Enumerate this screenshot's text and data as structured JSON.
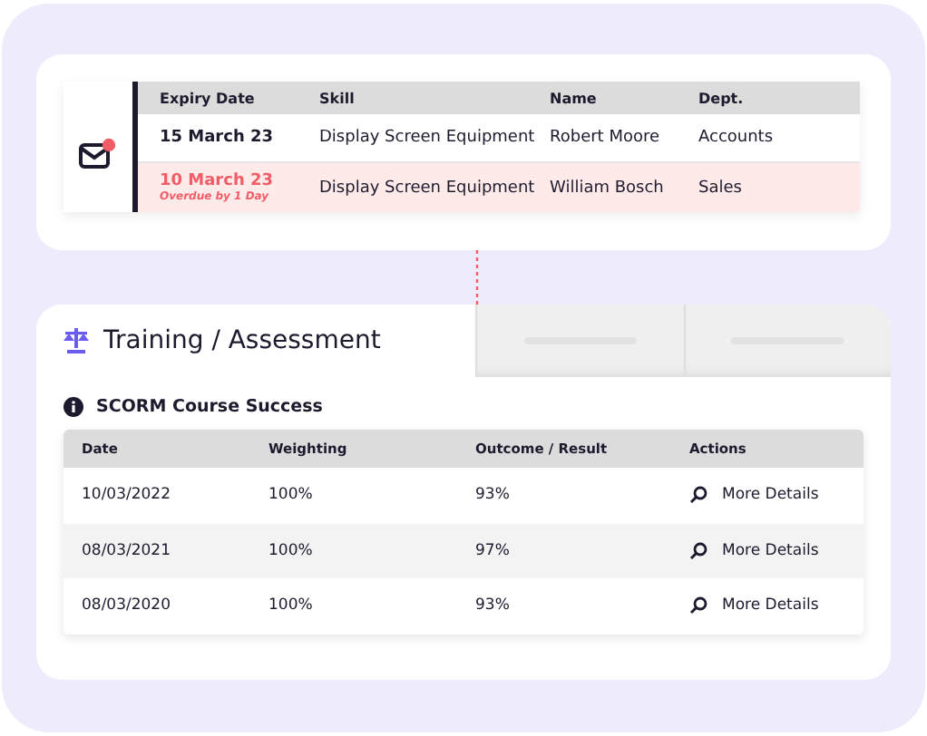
{
  "notifications": {
    "columns": [
      "Expiry Date",
      "Skill",
      "Name",
      "Dept."
    ],
    "rows": [
      {
        "expiry": "15 March 23",
        "skill": "Display Screen Equipment",
        "name": "Robert Moore",
        "dept": "Accounts",
        "overdue": false
      },
      {
        "expiry": "10 March 23",
        "note": "Overdue by 1 Day",
        "skill": "Display Screen Equipment",
        "name": "William Bosch",
        "dept": "Sales",
        "overdue": true
      }
    ],
    "unread": true
  },
  "tabs": [
    {
      "label": "Training / Assessment",
      "selected": true
    },
    {
      "selected": false
    },
    {
      "selected": false
    }
  ],
  "section_title": "SCORM Course Success",
  "table": {
    "columns": [
      "Date",
      "Weighting",
      "Outcome / Result",
      "Actions"
    ],
    "rows": [
      {
        "date": "10/03/2022",
        "weighting": "100%",
        "outcome": "93%",
        "action": "More Details"
      },
      {
        "date": "08/03/2021",
        "weighting": "100%",
        "outcome": "97%",
        "action": "More Details"
      },
      {
        "date": "08/03/2020",
        "weighting": "100%",
        "outcome": "93%",
        "action": "More Details"
      }
    ]
  }
}
